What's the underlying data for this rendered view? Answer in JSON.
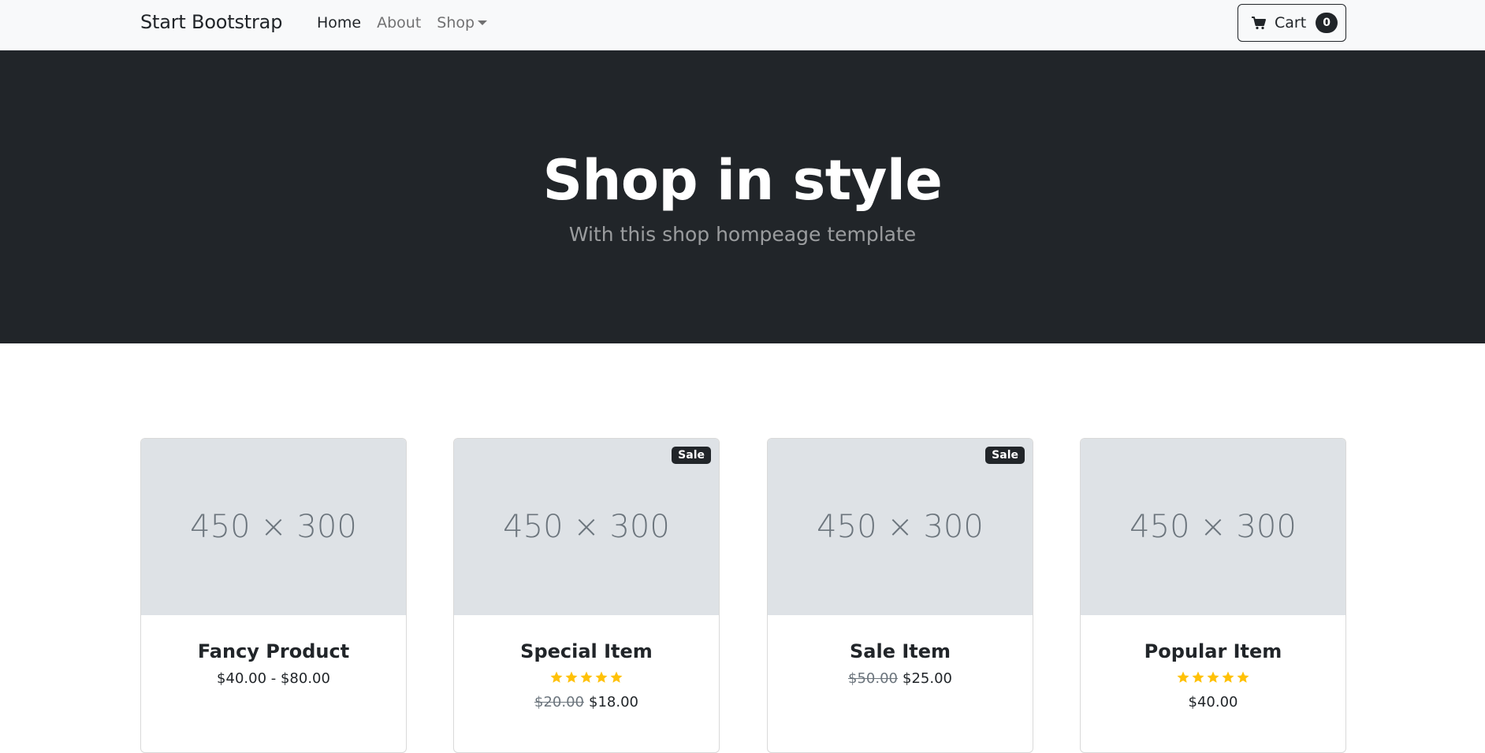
{
  "navbar": {
    "brand": "Start Bootstrap",
    "links": [
      {
        "label": "Home",
        "active": true
      },
      {
        "label": "About",
        "active": false
      },
      {
        "label": "Shop",
        "active": false,
        "dropdown": true
      }
    ],
    "cart": {
      "label": "Cart",
      "count": "0",
      "icon": "cart-icon"
    }
  },
  "hero": {
    "title": "Shop in style",
    "subtitle": "With this shop hompeage template"
  },
  "products": [
    {
      "name": "Fancy Product",
      "image_text": "450 × 300",
      "sale": false,
      "rating": 0,
      "old_price": "",
      "price": "$40.00 - $80.00"
    },
    {
      "name": "Special Item",
      "image_text": "450 × 300",
      "sale": true,
      "sale_label": "Sale",
      "rating": 5,
      "old_price": "$20.00",
      "price": "$18.00"
    },
    {
      "name": "Sale Item",
      "image_text": "450 × 300",
      "sale": true,
      "sale_label": "Sale",
      "rating": 0,
      "old_price": "$50.00",
      "price": "$25.00"
    },
    {
      "name": "Popular Item",
      "image_text": "450 × 300",
      "sale": false,
      "rating": 5,
      "old_price": "",
      "price": "$40.00"
    }
  ],
  "colors": {
    "navbar_bg": "#f8f9fa",
    "hero_bg": "#212529",
    "star": "#ffc107",
    "image_placeholder": "#dee2e6"
  }
}
